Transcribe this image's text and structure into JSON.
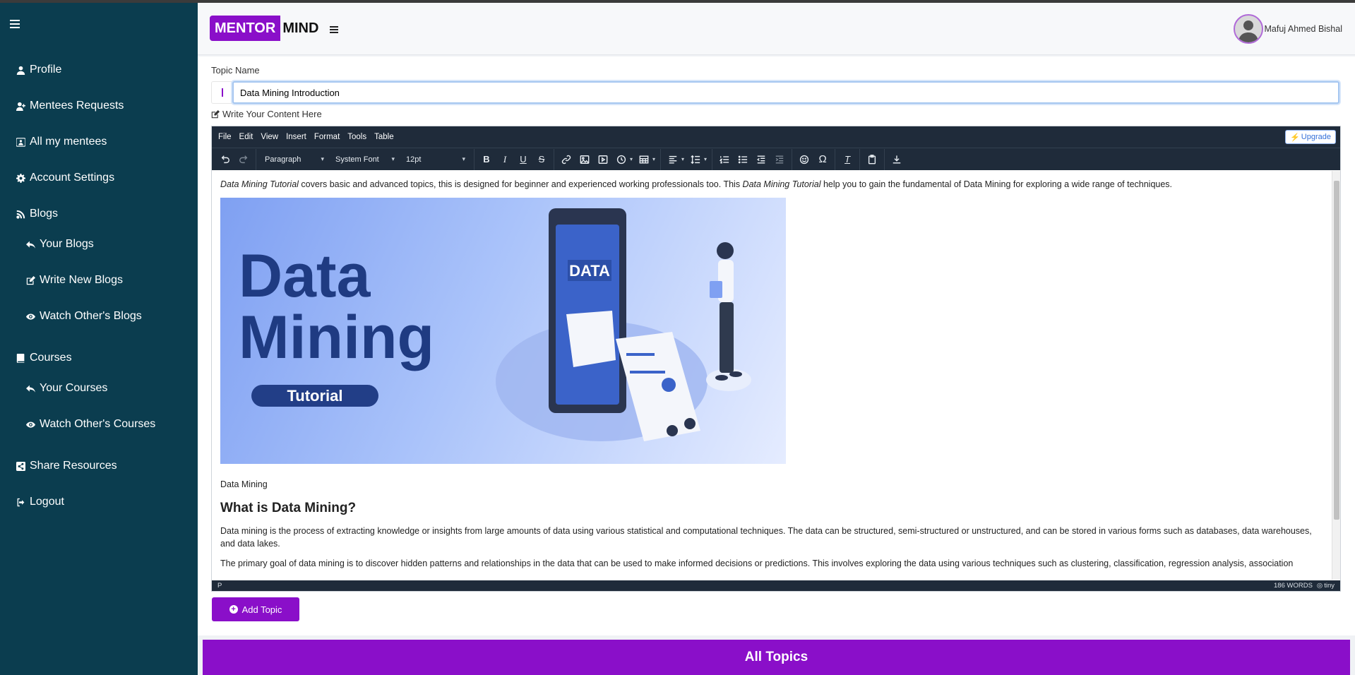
{
  "app": {
    "logo_part1": "MENTOR",
    "logo_part2": "MIND",
    "brand_color": "#8a0fc9",
    "sidebar_color": "#0b3d4f"
  },
  "user": {
    "name": "Mafuj Ahmed Bishal",
    "avatar_icon": "user-avatar"
  },
  "sidebar": {
    "items": [
      {
        "label": "Profile",
        "icon": "user-icon"
      },
      {
        "label": "Mentees Requests",
        "icon": "user-plus-icon"
      },
      {
        "label": "All my mentees",
        "icon": "users-icon"
      },
      {
        "label": "Account Settings",
        "icon": "gear-icon"
      },
      {
        "label": "Blogs",
        "icon": "blog-icon"
      },
      {
        "label": "Your Blogs",
        "icon": "reply-icon"
      },
      {
        "label": "Write New Blogs",
        "icon": "edit-icon"
      },
      {
        "label": "Watch Other's Blogs",
        "icon": "eye-icon"
      },
      {
        "label": "Courses",
        "icon": "book-icon"
      },
      {
        "label": "Your Courses",
        "icon": "reply-icon"
      },
      {
        "label": "Watch Other's Courses",
        "icon": "eye-icon"
      },
      {
        "label": "Share Resources",
        "icon": "share-icon"
      },
      {
        "label": "Logout",
        "icon": "logout-icon"
      }
    ]
  },
  "form": {
    "topic_label": "Topic Name",
    "topic_value": "Data Mining Introduction",
    "content_label": "Write Your Content Here"
  },
  "editor": {
    "menu": [
      "File",
      "Edit",
      "View",
      "Insert",
      "Format",
      "Tools",
      "Table"
    ],
    "upgrade_label": "Upgrade",
    "block_format": "Paragraph",
    "font_family": "System Font",
    "font_size": "12pt",
    "intro_em1": "Data Mining Tutorial",
    "intro_text1": " covers basic and advanced topics, this is designed for beginner and experienced working professionals too. This ",
    "intro_em2": "Data Mining Tutorial",
    "intro_text2": " help you to gain the fundamental of Data Mining for exploring a wide range of techniques.",
    "hero_line1": "Data",
    "hero_line2": "Mining",
    "hero_pill": "Tutorial",
    "hero_badge": "DATA",
    "caption": "Data Mining",
    "heading": "What is Data Mining?",
    "para1": "Data mining is the process of extracting knowledge or insights from large amounts of data using various statistical and computational techniques. The data can be structured, semi-structured or unstructured, and can be stored in various forms such as databases, data warehouses, and data lakes.",
    "para2": "The primary goal of data mining is to discover hidden patterns and relationships in the data that can be used to make informed decisions or predictions. This involves exploring the data using various techniques such as clustering, classification, regression analysis, association",
    "status_path": "P",
    "word_count": "186 WORDS",
    "brand": "tiny"
  },
  "actions": {
    "add_topic": "Add Topic",
    "all_topics": "All Topics"
  }
}
